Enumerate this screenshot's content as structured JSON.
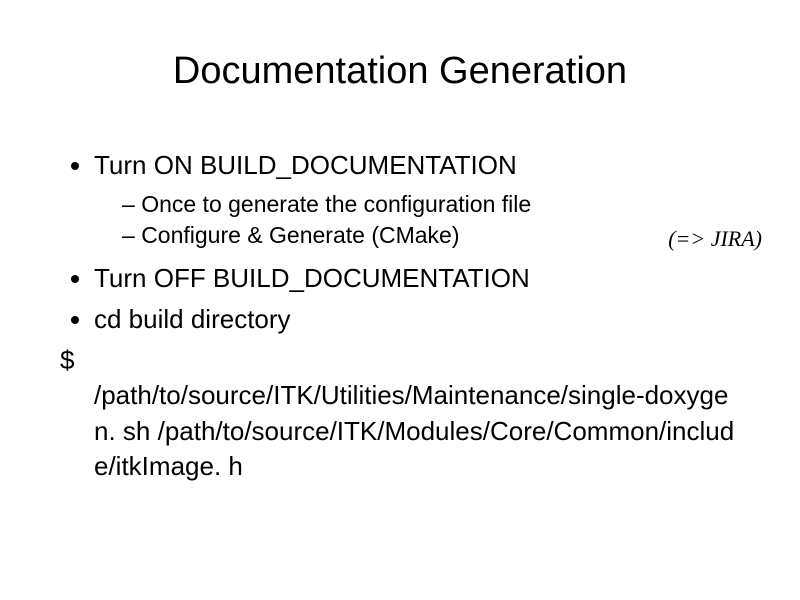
{
  "title": "Documentation Generation",
  "bullets": {
    "b1": "Turn ON BUILD_DOCUMENTATION",
    "b1_sub1": "Once to generate the configuration file",
    "b1_sub2": "Configure & Generate (CMake)",
    "b2": "Turn OFF BUILD_DOCUMENTATION",
    "b3": "cd build directory"
  },
  "dollar": "$",
  "command": "/path/to/source/ITK/Utilities/Maintenance/single-doxygen. sh /path/to/source/ITK/Modules/Core/Common/include/itkImage. h",
  "jira_note": "(=> JIRA)"
}
